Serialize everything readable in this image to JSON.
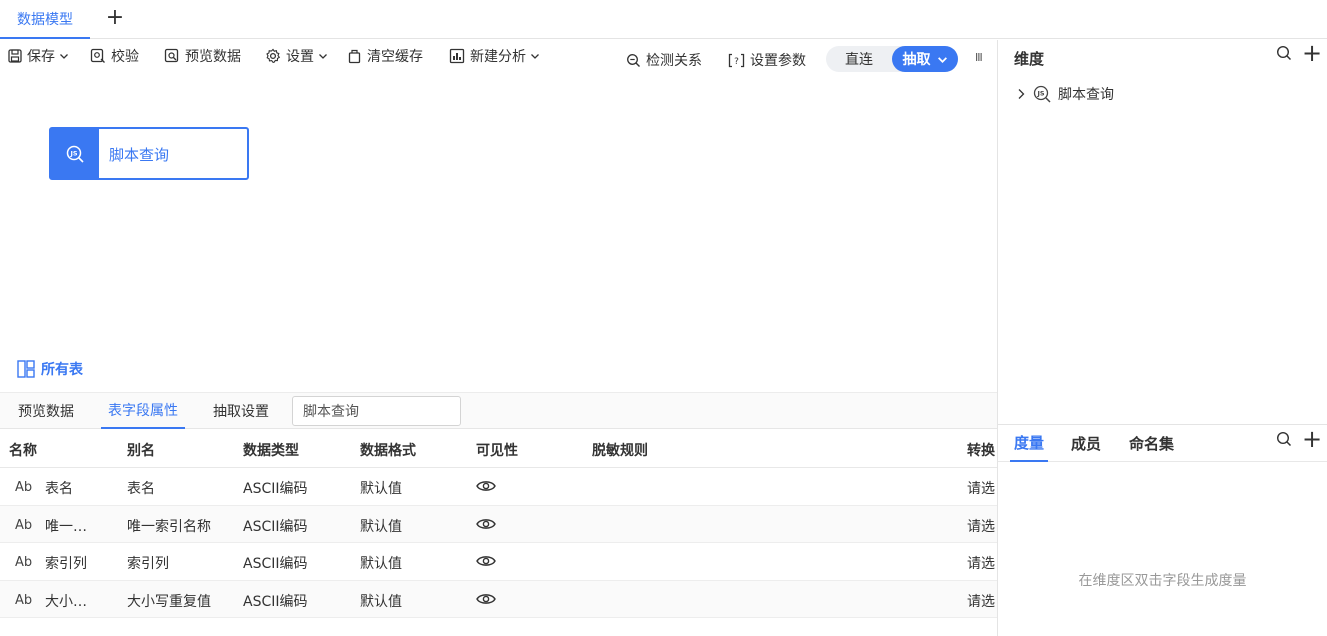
{
  "tabbar": {
    "active_tab": "数据模型",
    "add_label": "+"
  },
  "toolbar": {
    "save": "保存",
    "validate": "校验",
    "preview": "预览数据",
    "settings": "设置",
    "clear_cache": "清空缓存",
    "new_analysis": "新建分析",
    "detect_relation": "检测关系",
    "set_params": "设置参数",
    "mode_direct": "直连",
    "mode_extract": "抽取",
    "more": "III"
  },
  "canvas": {
    "node_label": "脚本查询",
    "all_tables": "所有表"
  },
  "bottom_tabs": {
    "preview": "预览数据",
    "field_props": "表字段属性",
    "extract_settings": "抽取设置",
    "table_name_value": "脚本查询"
  },
  "table": {
    "headers": [
      "名称",
      "别名",
      "数据类型",
      "数据格式",
      "可见性",
      "脱敏规则",
      "转换"
    ],
    "rows": [
      {
        "type_icon": "Ab",
        "name": "表名",
        "alias": "表名",
        "dtype": "ASCII编码",
        "format": "默认值",
        "transform": "请选"
      },
      {
        "type_icon": "Ab",
        "name": "唯一…",
        "alias": "唯一索引名称",
        "dtype": "ASCII编码",
        "format": "默认值",
        "transform": "请选"
      },
      {
        "type_icon": "Ab",
        "name": "索引列",
        "alias": "索引列",
        "dtype": "ASCII编码",
        "format": "默认值",
        "transform": "请选"
      },
      {
        "type_icon": "Ab",
        "name": "大小…",
        "alias": "大小写重复值",
        "dtype": "ASCII编码",
        "format": "默认值",
        "transform": "请选"
      }
    ]
  },
  "right_panel": {
    "title": "维度",
    "tree_item": "脚本查询",
    "tabs": [
      "度量",
      "成员",
      "命名集"
    ],
    "empty_text": "在维度区双击字段生成度量",
    "add_label": "+"
  },
  "colors": {
    "accent": "#3a78f2"
  }
}
